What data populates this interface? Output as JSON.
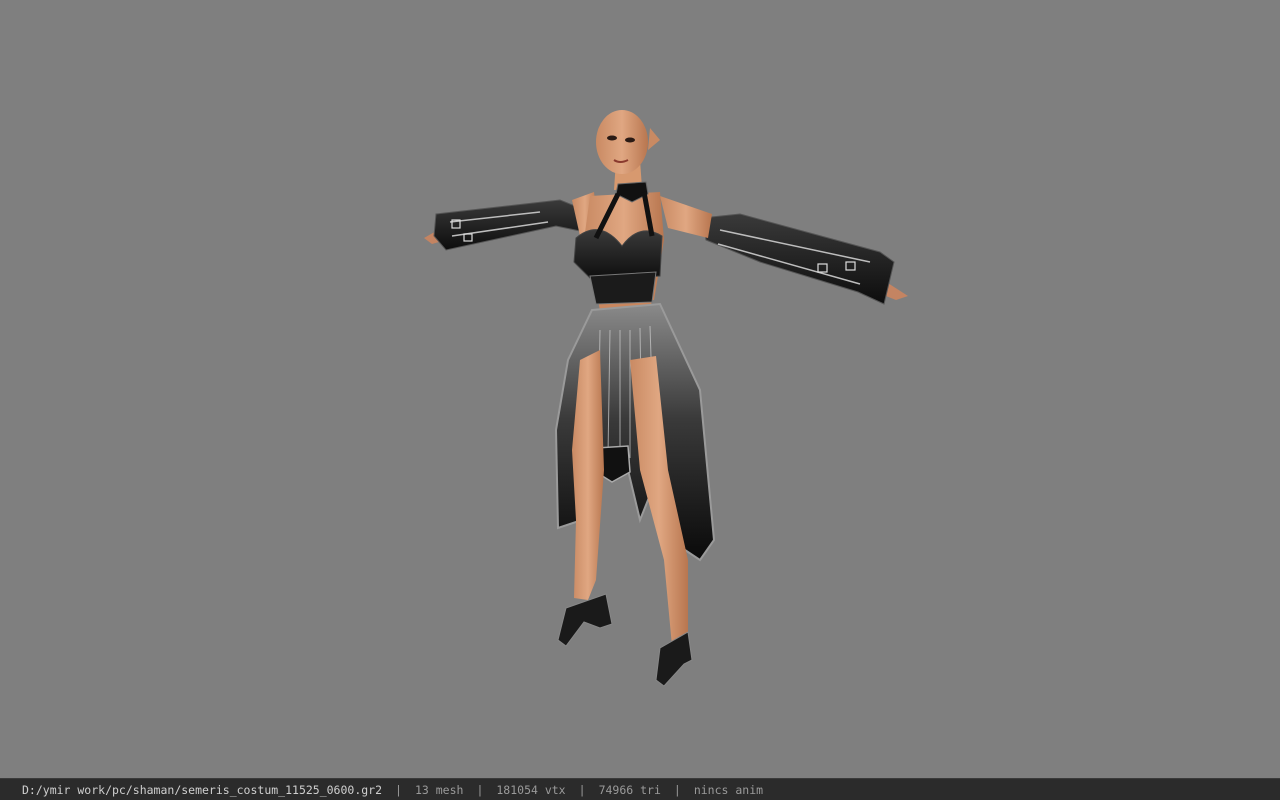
{
  "viewer": {
    "background_color": "#7f7f7f",
    "statusbar_color": "#2b2b2b"
  },
  "statusbar": {
    "file_path": "D:/ymir work/pc/shaman/semeris_costum_11525_0600.gr2",
    "separator": "|",
    "mesh_count": "13 mesh",
    "vertex_count": "181054 vtx",
    "triangle_count": "74966 tri",
    "animation_status": "nincs anim"
  }
}
